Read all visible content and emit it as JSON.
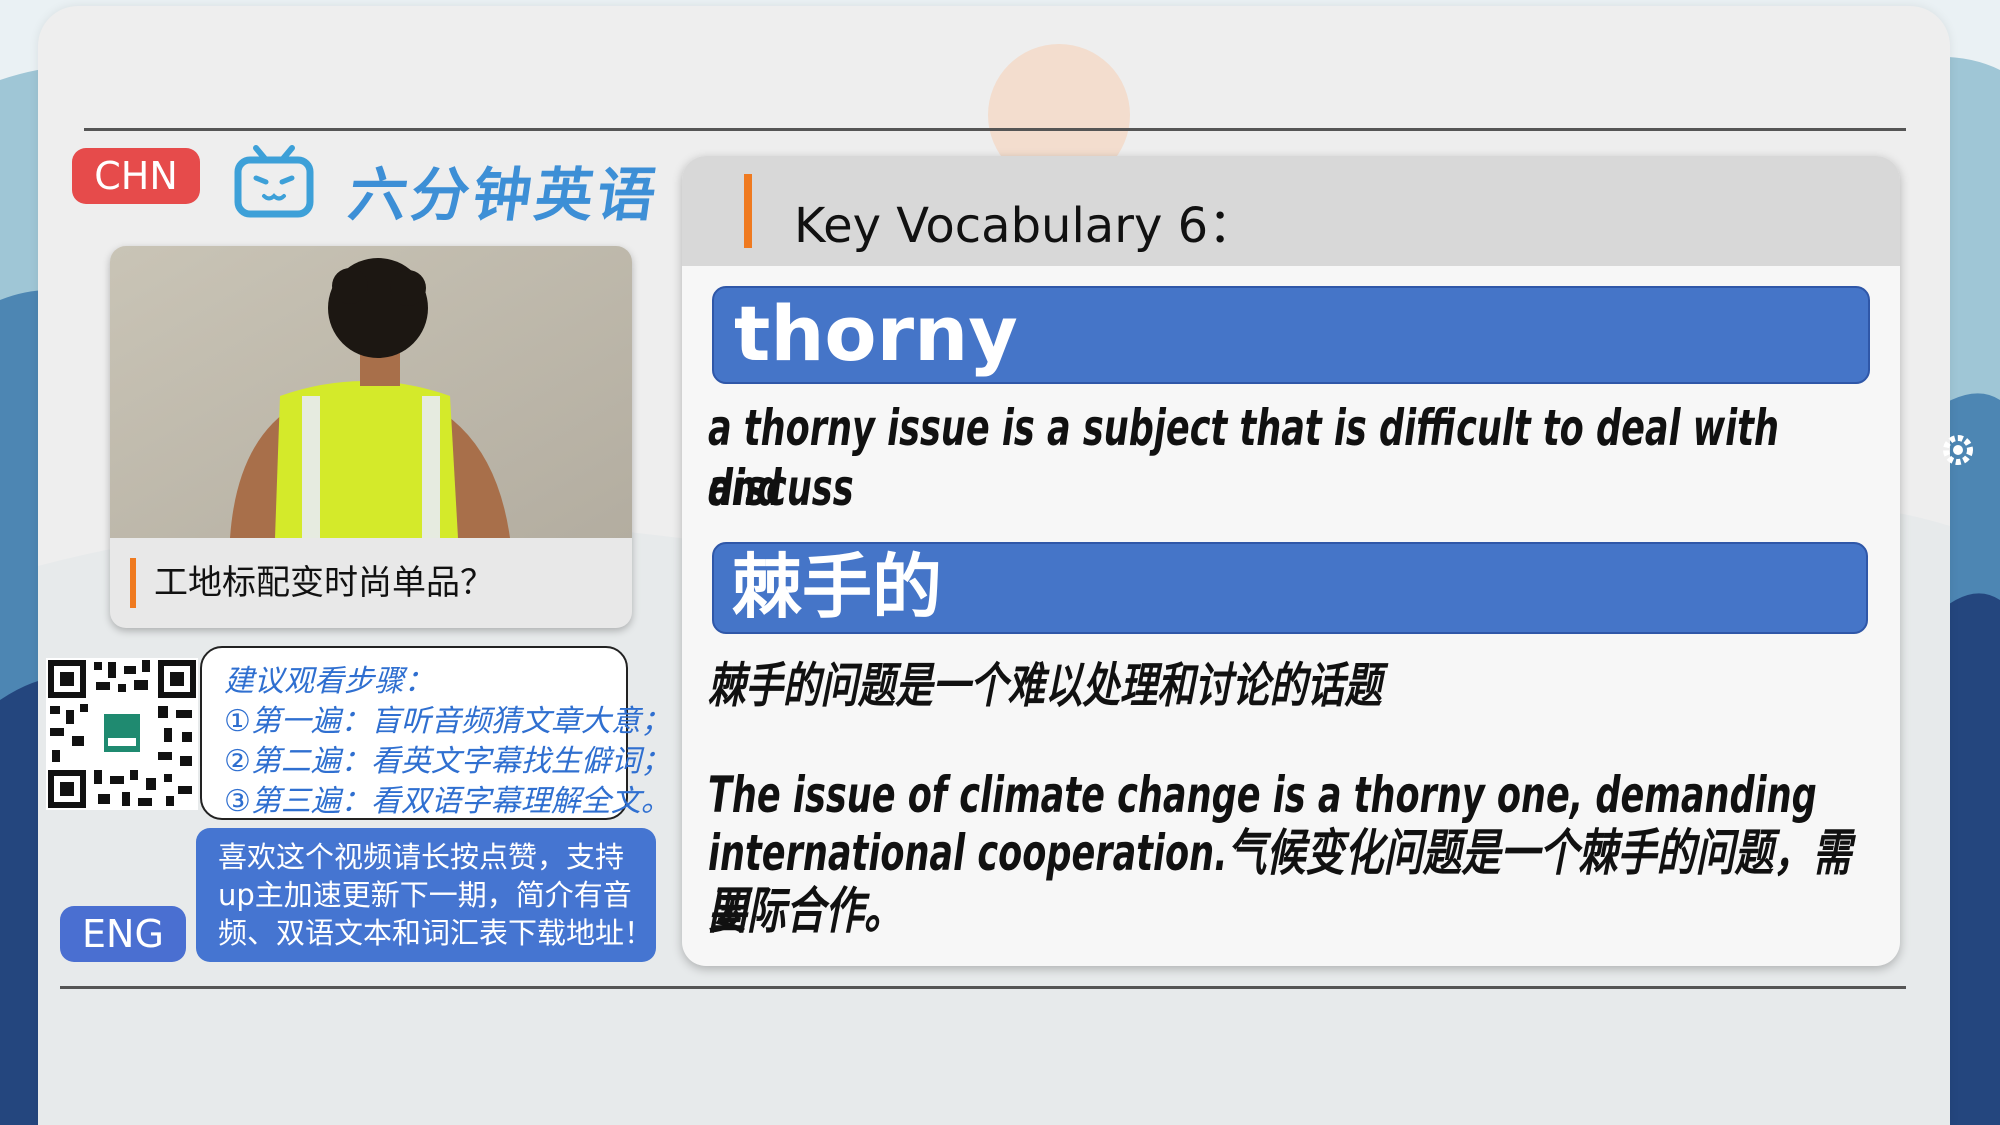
{
  "tags": {
    "chn": "CHN",
    "eng": "ENG"
  },
  "brand": {
    "title": "六分钟英语"
  },
  "thumbnail": {
    "caption": "工地标配变时尚单品？"
  },
  "steps": {
    "title": "建议观看步骤：",
    "lines": [
      "①第一遍：盲听音频猜文章大意；",
      "②第二遍：看英文字幕找生僻词；",
      "③第三遍：看双语字幕理解全文。"
    ]
  },
  "support": {
    "lines": [
      "喜欢这个视频请长按点赞，支持",
      "up主加速更新下一期，简介有音",
      "频、双语文本和词汇表下载地址！"
    ]
  },
  "vocab": {
    "heading": "Key Vocabulary 6：",
    "word_en": "thorny",
    "definition_en_1": "a thorny issue is a subject that is difficult to deal with and",
    "definition_en_2": "discuss",
    "word_zh": "棘手的",
    "definition_zh": "棘手的问题是一个难以处理和讨论的话题",
    "example_1": "The issue of climate change is a thorny one, demanding",
    "example_2": "international cooperation.气候变化问题是一个棘手的问题，需要",
    "example_3": "国际合作。"
  },
  "colors": {
    "accent_orange": "#ef7a20",
    "tag_red": "#e64b4b",
    "tag_blue": "#4a6fd1",
    "word_bar": "#4575c8"
  }
}
